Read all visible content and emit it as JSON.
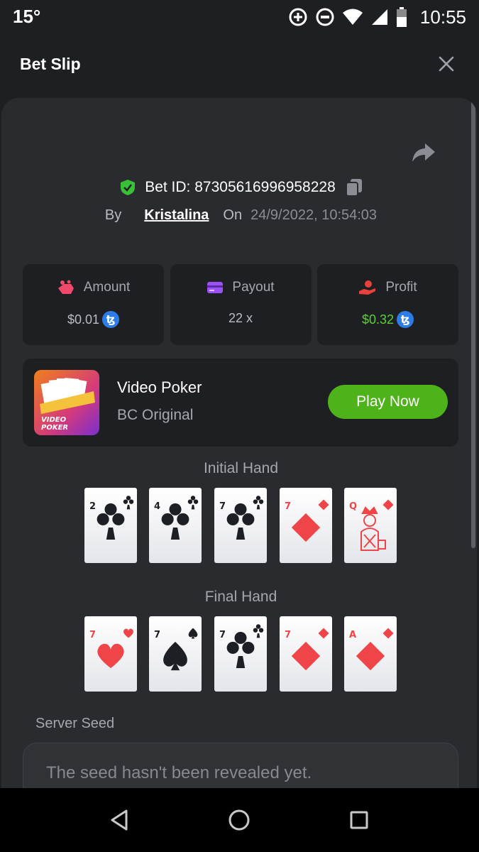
{
  "status_bar": {
    "temperature": "15°",
    "time": "10:55"
  },
  "header": {
    "title": "Bet Slip"
  },
  "bet": {
    "id_text": "Bet ID: 87305616996958228",
    "by_label": "By",
    "user": "Kristalina",
    "on_label": "On",
    "date": "24/9/2022, 10:54:03"
  },
  "stats": {
    "amount": {
      "label": "Amount",
      "value": "$0.01",
      "currency_symbol": "ꜩ"
    },
    "payout": {
      "label": "Payout",
      "value": "22 x"
    },
    "profit": {
      "label": "Profit",
      "value": "$0.32",
      "currency_symbol": "ꜩ"
    }
  },
  "game": {
    "name": "Video Poker",
    "provider": "BC Original",
    "play_label": "Play Now",
    "thumb_text_line1": "VIDEO",
    "thumb_text_line2": "POKER"
  },
  "hands": {
    "initial_label": "Initial Hand",
    "final_label": "Final Hand",
    "initial": [
      {
        "rank": "2",
        "suit": "club"
      },
      {
        "rank": "4",
        "suit": "club"
      },
      {
        "rank": "7",
        "suit": "club"
      },
      {
        "rank": "7",
        "suit": "diamond"
      },
      {
        "rank": "Q",
        "suit": "diamond"
      }
    ],
    "final": [
      {
        "rank": "7",
        "suit": "heart"
      },
      {
        "rank": "7",
        "suit": "spade"
      },
      {
        "rank": "7",
        "suit": "club"
      },
      {
        "rank": "7",
        "suit": "diamond"
      },
      {
        "rank": "A",
        "suit": "diamond"
      }
    ]
  },
  "server_seed": {
    "label": "Server Seed",
    "placeholder": "The seed hasn't been revealed yet."
  },
  "colors": {
    "accent_green": "#4eb21a",
    "profit_green": "#5ad134",
    "suit_red": "#f04548",
    "suit_black": "#1d1f24",
    "tezos_blue": "#2d7de8"
  }
}
